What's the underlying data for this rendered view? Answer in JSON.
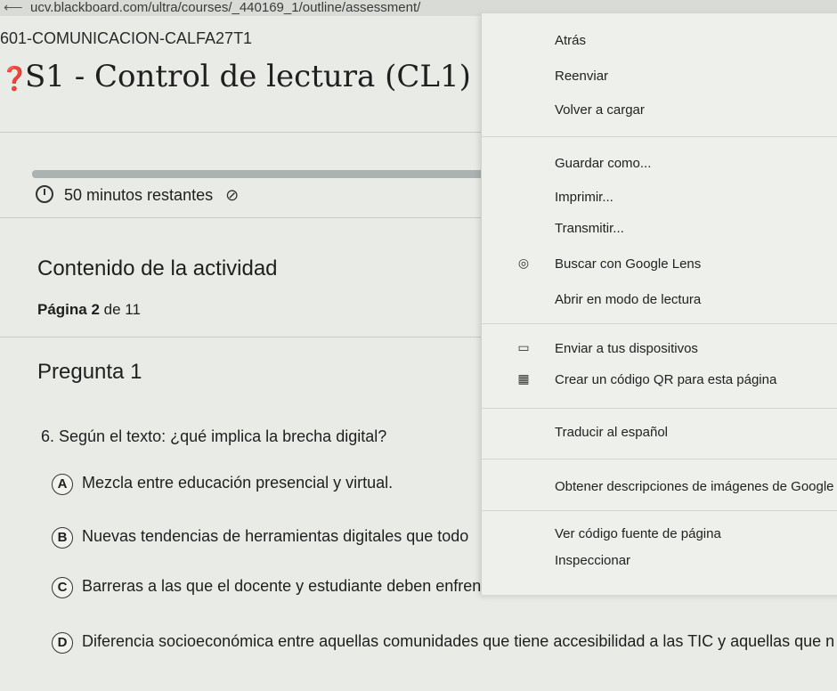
{
  "browser": {
    "url": "ucv.blackboard.com/ultra/courses/_440169_1/outline/assessment/"
  },
  "course": {
    "name": "601-COMUNICACION-CALFA27T1"
  },
  "assessment": {
    "title": "S1 - Control de lectura (CL1)",
    "timer": {
      "text": "50 minutos restantes"
    },
    "progress_fraction": 0.98
  },
  "content": {
    "section_title": "Contenido de la actividad",
    "page_bold": "Página 2",
    "page_rest": " de 11",
    "question_title": "Pregunta 1",
    "question_text": "6. Según el texto: ¿qué implica la brecha digital?",
    "options": [
      {
        "letter": "A",
        "text": "Mezcla entre educación presencial y virtual."
      },
      {
        "letter": "B",
        "text": "Nuevas tendencias de herramientas digitales que todo"
      },
      {
        "letter": "C",
        "text": "Barreras a las que el docente y estudiante deben enfrentarse."
      },
      {
        "letter": "D",
        "text": "Diferencia socioeconómica entre aquellas comunidades que tiene accesibilidad a las TIC y aquellas que n"
      }
    ]
  },
  "context_menu": {
    "items": [
      {
        "label": "Atrás"
      },
      {
        "label": "Reenviar"
      },
      {
        "label": "Volver a cargar"
      },
      {
        "label": "Guardar como..."
      },
      {
        "label": "Imprimir..."
      },
      {
        "label": "Transmitir..."
      },
      {
        "label": "Buscar con Google Lens",
        "icon": "lens-icon"
      },
      {
        "label": "Abrir en modo de lectura"
      },
      {
        "label": "Enviar a tus dispositivos",
        "icon": "devices-icon"
      },
      {
        "label": "Crear un código QR para esta página",
        "icon": "qr-icon"
      },
      {
        "label": "Traducir al español"
      },
      {
        "label": "Obtener descripciones de imágenes de Google"
      },
      {
        "label": "Ver código fuente de página"
      },
      {
        "label": "Inspeccionar"
      }
    ]
  }
}
